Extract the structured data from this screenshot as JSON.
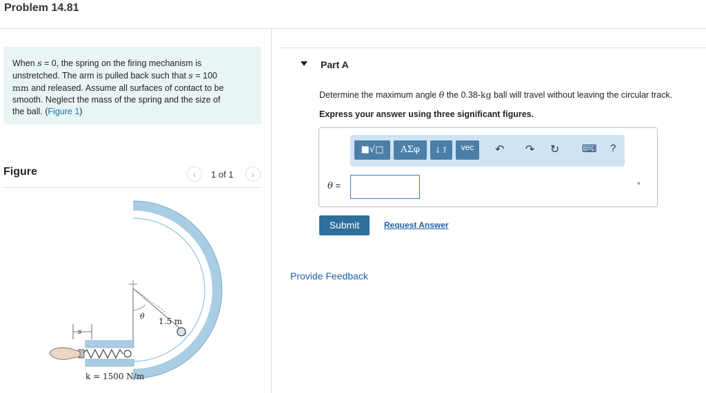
{
  "header": {
    "title": "Problem 14.81"
  },
  "problem": {
    "line1_pre": "When ",
    "line1_var": "s",
    "line1_post": " = 0, the spring on the firing mechanism is",
    "line2_pre": "unstretched. The arm is pulled back such that ",
    "line2_var": "s",
    "line2_post": " = 100",
    "line3_unit": "mm",
    "line3_post": " and released. Assume all surfaces of contact to be",
    "line4": "smooth. Neglect the mass of the spring and the size of",
    "line5_pre": "the ball. (",
    "line5_link": "Figure 1",
    "line5_post": ")"
  },
  "figure": {
    "label": "Figure",
    "pager": "1 of 1",
    "prev_icon": "chevron-left-icon",
    "next_icon": "chevron-right-icon",
    "radius_label": "1.5 m",
    "theta_label": "θ",
    "s_label": "s",
    "k_label": "k = 1500 N/m"
  },
  "part": {
    "title": "Part A",
    "question_pre": "Determine the maximum angle ",
    "question_var": "θ",
    "question_mid": " the 0.38-",
    "question_unit": "kg",
    "question_post": " ball will travel without leaving the circular track.",
    "instruction": "Express your answer using three significant figures."
  },
  "toolbar": {
    "btn_templates": "■√□",
    "btn_greek": "ΑΣφ",
    "btn_arrows": "↓↑",
    "btn_vec": "vec",
    "undo_icon": "↶",
    "redo_icon": "↷",
    "reset_icon": "↻",
    "keyboard_icon": "⌨",
    "help": "?"
  },
  "answer": {
    "var_label": "θ",
    "equals": " =",
    "value": "",
    "unit": "°"
  },
  "buttons": {
    "submit": "Submit",
    "request": "Request Answer"
  },
  "feedback": "Provide Feedback",
  "colors": {
    "accent": "#2e6f9e",
    "link": "#1f5fa8",
    "problem_bg": "#e9f5f4",
    "toolbar_bg": "#cfe3f5"
  }
}
